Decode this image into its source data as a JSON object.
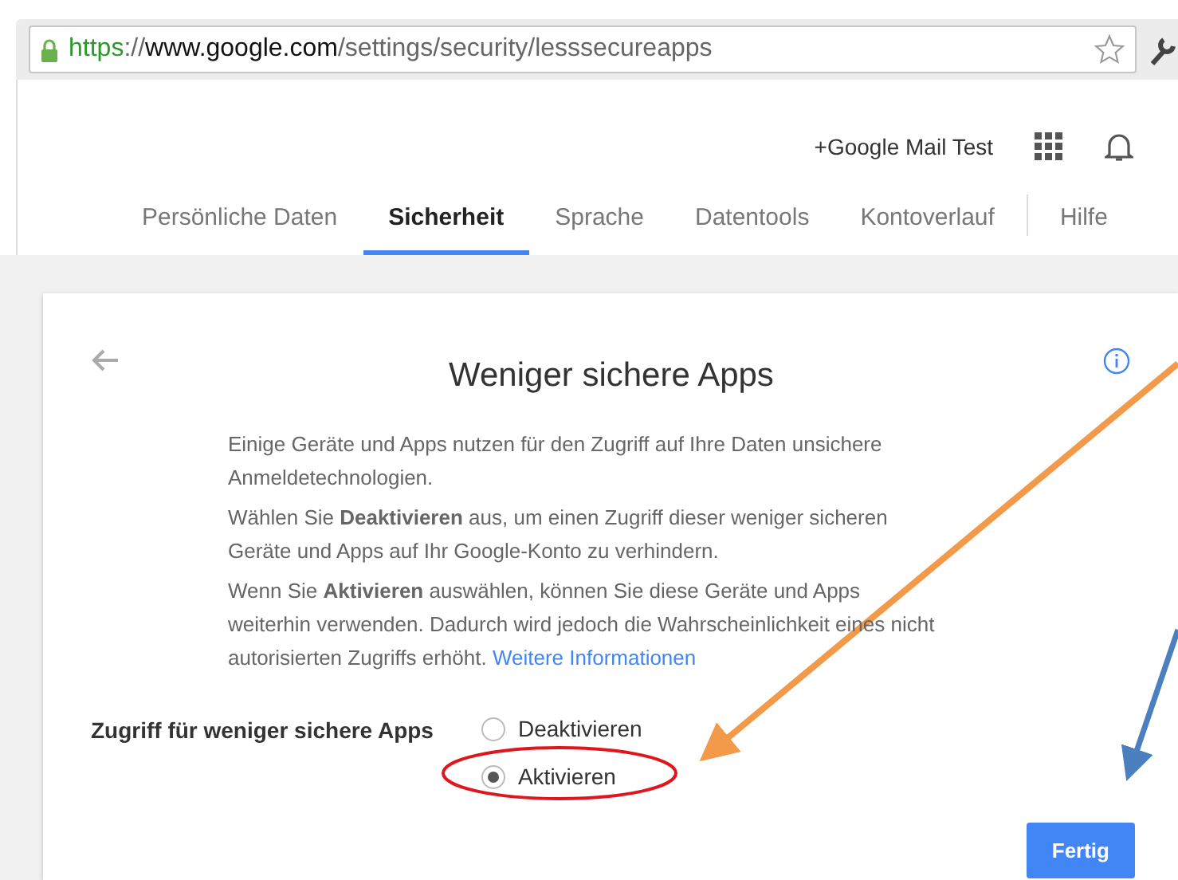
{
  "address_bar": {
    "url": [
      {
        "kind": "scheme",
        "text": "https"
      },
      {
        "kind": "separator",
        "text": "://"
      },
      {
        "kind": "host",
        "text": "www.google.com"
      },
      {
        "kind": "path",
        "text": "/settings/security/lesssecureapps"
      }
    ]
  },
  "header": {
    "account": "+Google Mail Test"
  },
  "tabs": [
    {
      "label": "Persönliche Daten",
      "selected": false
    },
    {
      "label": "Sicherheit",
      "selected": true
    },
    {
      "label": "Sprache",
      "selected": false
    },
    {
      "label": "Datentools",
      "selected": false
    },
    {
      "label": "Kontoverlauf",
      "selected": false
    },
    {
      "label": "Hilfe",
      "selected": false
    }
  ],
  "card": {
    "title": "Weniger sichere Apps",
    "paragraphs": [
      "Einige Geräte und Apps nutzen für den Zugriff auf Ihre Daten unsichere Anmeldetechnologien.",
      "Wählen Sie **Deaktivieren** aus, um einen Zugriff dieser weniger sicheren Geräte und Apps auf Ihr Google-Konto zu verhindern.",
      "Wenn Sie **Aktivieren** auswählen, können Sie diese Geräte und Apps weiterhin verwenden. Dadurch wird jedoch die Wahrscheinlichkeit eines nicht autorisierten Zugriffs erhöht."
    ],
    "link": "Weitere Informationen",
    "setting_label": "Zugriff für weniger sichere Apps",
    "options": [
      {
        "label": "Deaktivieren",
        "selected": false
      },
      {
        "label": "Aktivieren",
        "selected": true
      }
    ],
    "button": "Fertig"
  }
}
